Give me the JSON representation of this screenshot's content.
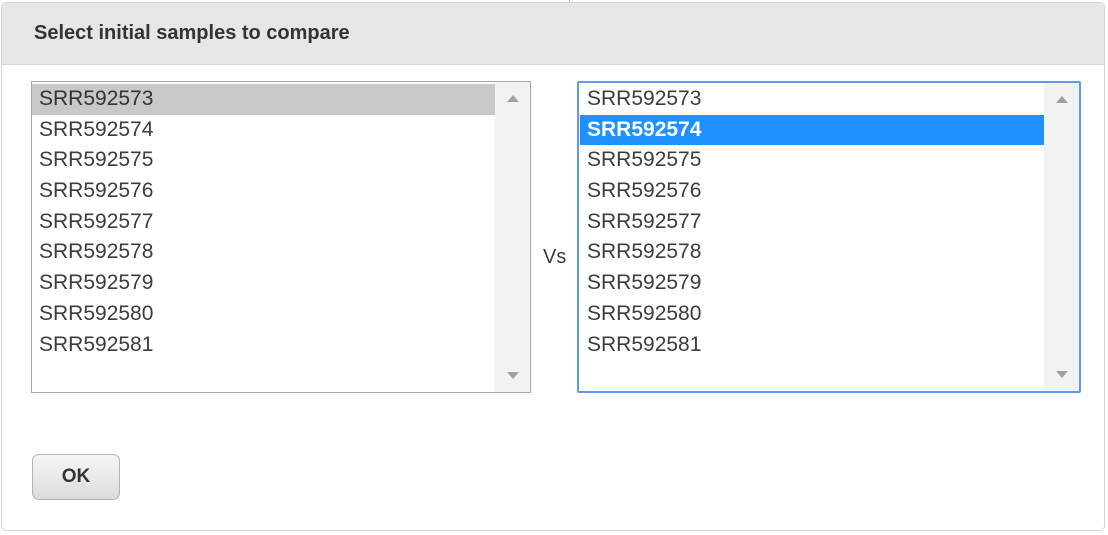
{
  "dialog": {
    "title": "Select initial samples to compare",
    "vs_label": "Vs",
    "ok_label": "OK"
  },
  "left_list": {
    "selected": "SRR592573",
    "options": [
      "SRR592573",
      "SRR592574",
      "SRR592575",
      "SRR592576",
      "SRR592577",
      "SRR592578",
      "SRR592579",
      "SRR592580",
      "SRR592581"
    ]
  },
  "right_list": {
    "selected": "SRR592574",
    "options": [
      "SRR592573",
      "SRR592574",
      "SRR592575",
      "SRR592576",
      "SRR592577",
      "SRR592578",
      "SRR592579",
      "SRR592580",
      "SRR592581"
    ]
  },
  "icons": {
    "scroll_up": "scroll-up-arrow-icon",
    "scroll_down": "scroll-down-arrow-icon"
  },
  "colors": {
    "header_bg": "#e6e6e6",
    "focus_border": "#5b9bf0",
    "active_selection": "#1e90ff",
    "inactive_selection": "#c8c8c8"
  }
}
